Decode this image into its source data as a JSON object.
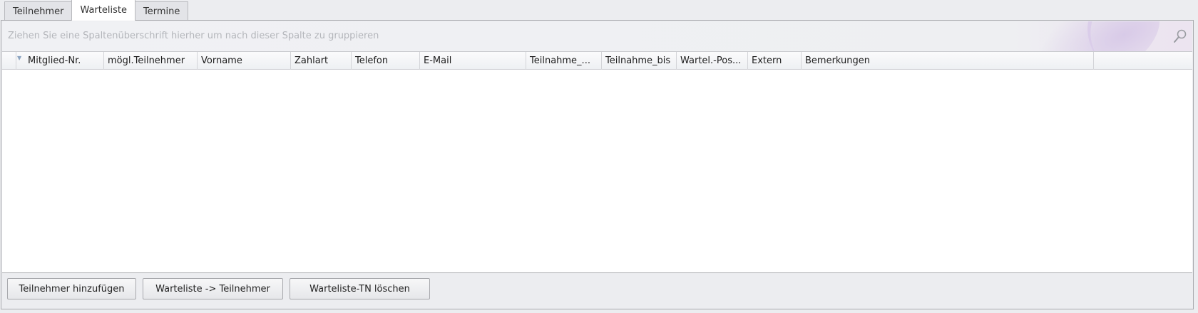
{
  "tabs": [
    {
      "label": "Teilnehmer",
      "active": false
    },
    {
      "label": "Warteliste",
      "active": true
    },
    {
      "label": "Termine",
      "active": false
    }
  ],
  "group_panel": {
    "hint": "Ziehen Sie eine Spaltenüberschrift hierher um nach dieser Spalte zu gruppieren",
    "search_icon": "search-icon"
  },
  "grid": {
    "columns": [
      "Mitglied-Nr.",
      "mögl.Teilnehmer",
      "Vorname",
      "Zahlart",
      "Telefon",
      "E-Mail",
      "Teilnahme_...",
      "Teilnahme_bis",
      "Wartel.-Pos...",
      "Extern",
      "Bemerkungen"
    ],
    "rows": []
  },
  "buttons": {
    "add": "Teilnehmer hinzufügen",
    "move": "Warteliste -> Teilnehmer",
    "delete": "Warteliste-TN löschen"
  },
  "colors": {
    "accent_swoosh": "#c8b4e1",
    "filter_icon": "#8aa3c0"
  }
}
